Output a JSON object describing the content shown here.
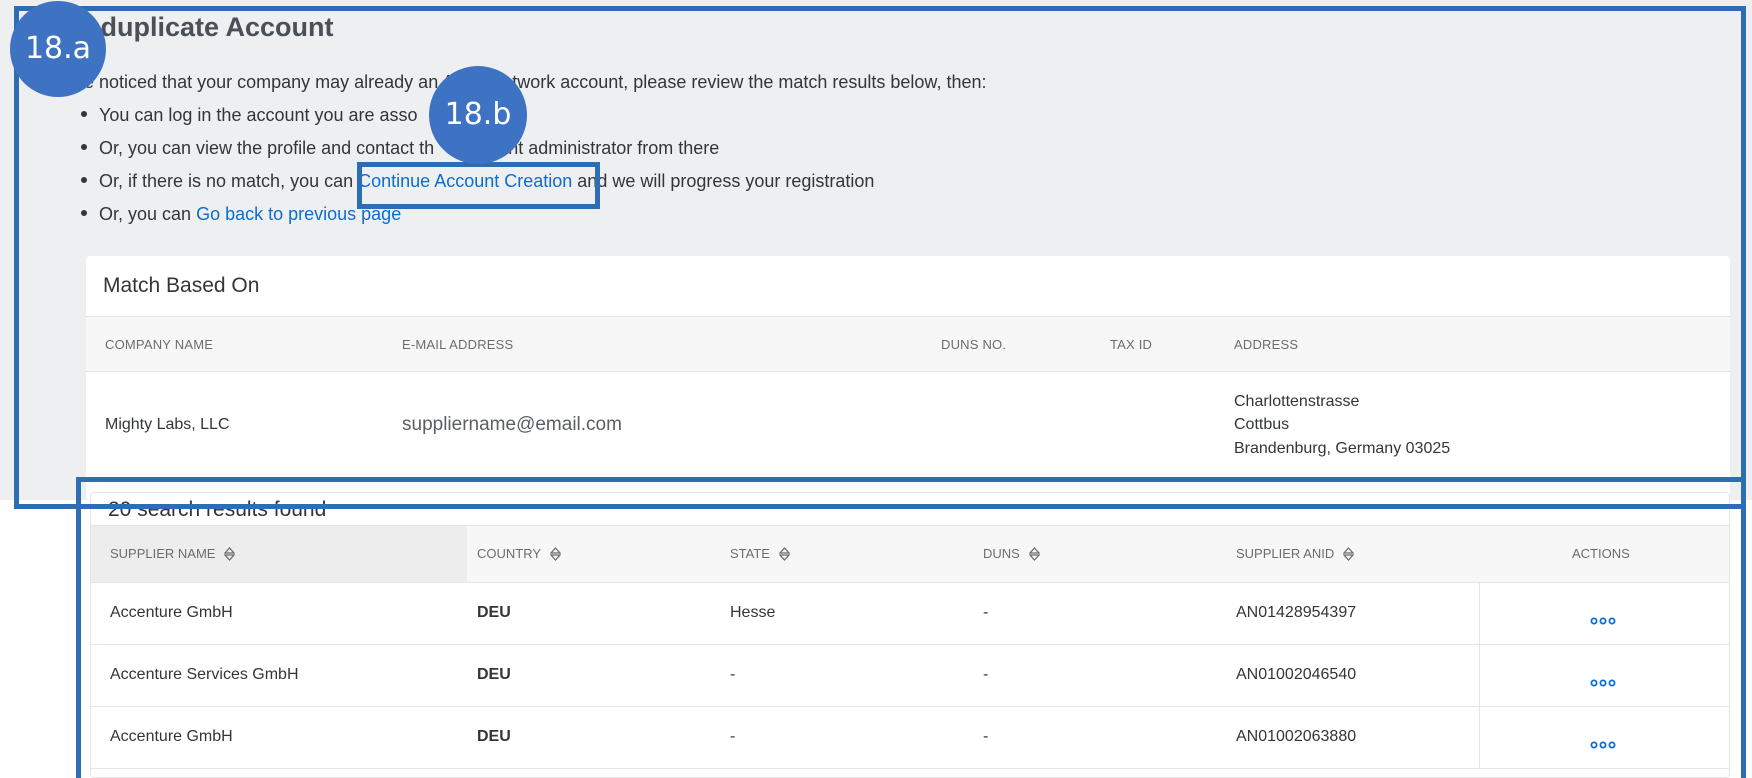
{
  "page": {
    "title": "w duplicate Account",
    "intro": "e noticed that your company may already                     an Ariba Network account, please review the match results below, then:",
    "bullets": {
      "b1": "You can log in the account you are asso",
      "b2_before": "Or, you can view the profile and contact th",
      "b2_after": "nt administrator from there",
      "b3_before": "Or, if there is no match, you can",
      "b3_link": "Continue Account Creation",
      "b3_after": "and we will progress your registration",
      "b4_before": "Or, you can",
      "b4_link": "Go back to previous page"
    }
  },
  "match": {
    "title": "Match Based On",
    "headers": {
      "company": "COMPANY NAME",
      "email": "E-MAIL ADDRESS",
      "duns": "DUNS NO.",
      "tax": "TAX ID",
      "address": "ADDRESS"
    },
    "row": {
      "company": "Mighty Labs, LLC",
      "email": "suppliername@email.com",
      "address_line1": "Charlottenstrasse",
      "address_line2": "Cottbus",
      "address_line3": "Brandenburg, Germany 03025"
    }
  },
  "results": {
    "title": "20 search results found",
    "headers": {
      "supplier_name": "SUPPLIER NAME",
      "country": "COUNTRY",
      "state": "STATE",
      "duns": "DUNS",
      "anid": "SUPPLIER ANID",
      "actions": "ACTIONS"
    },
    "rows": [
      {
        "name": "Accenture GmbH",
        "country": "DEU",
        "state": "Hesse",
        "duns": "-",
        "anid": "AN01428954397"
      },
      {
        "name": "Accenture Services GmbH",
        "country": "DEU",
        "state": "-",
        "duns": "-",
        "anid": "AN01002046540"
      },
      {
        "name": "Accenture GmbH",
        "country": "DEU",
        "state": "-",
        "duns": "-",
        "anid": "AN01002063880"
      }
    ]
  },
  "markers": {
    "a": "18.a",
    "b": "18.b"
  },
  "colors": {
    "link": "#0a6ed1",
    "highlight_box": "#2e6db4",
    "marker": "#3e72c2",
    "panel_bg": "#edeff0"
  },
  "icons": {
    "sort": "sort-icon",
    "more": "more-actions-icon"
  }
}
